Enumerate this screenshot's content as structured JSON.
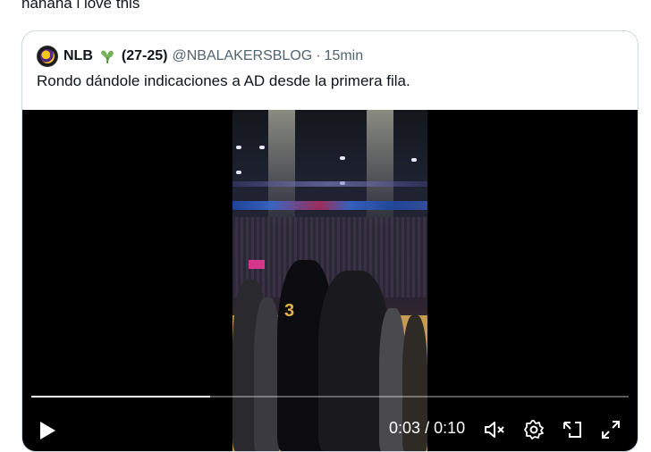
{
  "tweet": {
    "text": "hahaha i love this"
  },
  "quote": {
    "display_name": "NLB",
    "record": "(27-25)",
    "handle": "@NBALAKERSBLOG",
    "separator": "·",
    "time": "15min",
    "text": "Rondo dándole indicaciones a AD desde la primera fila."
  },
  "video": {
    "current_time": "0:03",
    "time_separator": "/",
    "duration": "0:10",
    "progress_fraction": 0.3,
    "jersey_number": "3",
    "icons": [
      "play-icon",
      "mute-icon",
      "settings-icon",
      "pip-icon",
      "fullscreen-icon"
    ]
  }
}
